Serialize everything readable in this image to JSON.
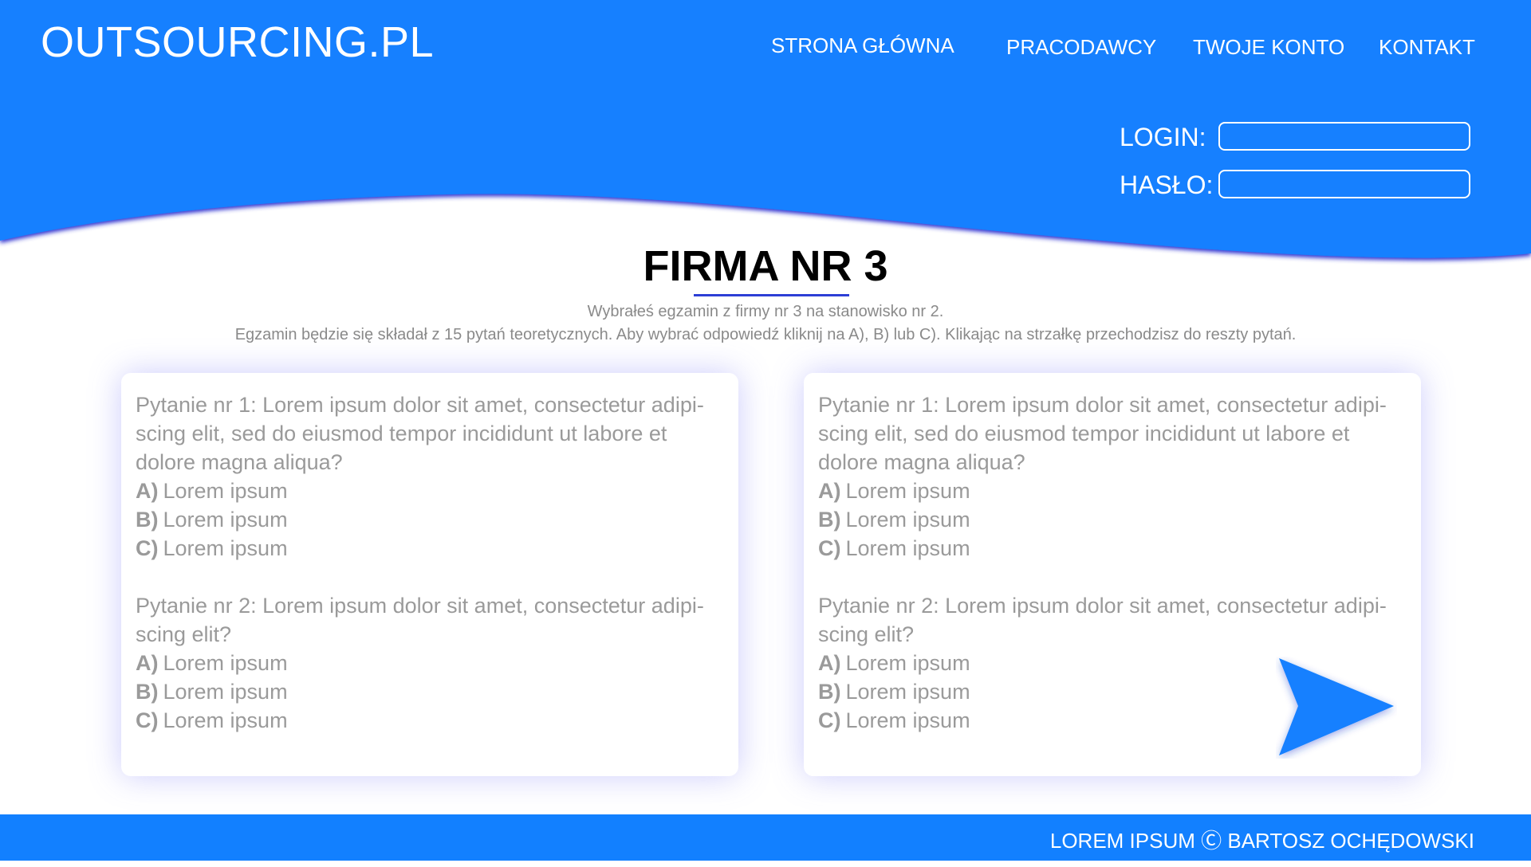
{
  "brand": {
    "logo": "OUTSOURCING.PL"
  },
  "nav": {
    "items": [
      {
        "label": "STRONA GŁÓWNA"
      },
      {
        "label": "PRACODAWCY"
      },
      {
        "label": "TWOJE KONTO"
      },
      {
        "label": "KONTAKT"
      }
    ]
  },
  "login": {
    "login_label": "LOGIN:",
    "login_value": "",
    "password_label": "HASŁO:",
    "password_value": ""
  },
  "page": {
    "title": "FIRMA NR 3",
    "subtitle_1": "Wybrałeś egzamin z firmy nr 3 na stanowisko nr 2.",
    "subtitle_2": "Egzamin będzie się składał z 15 pytań teoretycznych. Aby wybrać odpowiedź kliknij na A), B) lub C). Klikając na strzałkę przechodzisz do reszty pytań."
  },
  "cards": [
    {
      "questions": [
        {
          "text": "Pytanie nr 1: Lorem ipsum dolor sit amet, consectetur adipi-scing elit, sed do eiusmod tempor incididunt ut labore et dolore magna aliqua?",
          "answers": [
            {
              "letter": "A)",
              "text": "Lorem ipsum"
            },
            {
              "letter": "B)",
              "text": "Lorem ipsum"
            },
            {
              "letter": "C)",
              "text": "Lorem ipsum"
            }
          ]
        },
        {
          "text": "Pytanie nr 2: Lorem ipsum dolor sit amet, consectetur adipi-scing elit?",
          "answers": [
            {
              "letter": "A)",
              "text": "Lorem ipsum"
            },
            {
              "letter": "B)",
              "text": "Lorem ipsum"
            },
            {
              "letter": "C)",
              "text": "Lorem ipsum"
            }
          ]
        }
      ]
    },
    {
      "questions": [
        {
          "text": "Pytanie nr 1: Lorem ipsum dolor sit amet, consectetur adipi-scing elit, sed do eiusmod tempor incididunt ut labore et dolore magna aliqua?",
          "answers": [
            {
              "letter": "A)",
              "text": "Lorem ipsum"
            },
            {
              "letter": "B)",
              "text": "Lorem ipsum"
            },
            {
              "letter": "C)",
              "text": "Lorem ipsum"
            }
          ]
        },
        {
          "text": "Pytanie nr 2: Lorem ipsum dolor sit amet, consectetur adipi-scing elit?",
          "answers": [
            {
              "letter": "A)",
              "text": "Lorem ipsum"
            },
            {
              "letter": "B)",
              "text": "Lorem ipsum"
            },
            {
              "letter": "C)",
              "text": "Lorem ipsum"
            }
          ]
        }
      ]
    }
  ],
  "next_button": {
    "icon": "arrow-right-icon"
  },
  "footer": {
    "text": "LOREM IPSUM Ⓒ BARTOSZ OCHĘDOWSKI"
  },
  "colors": {
    "primary": "#1280ff",
    "wave_shadow": "#2b2fd0",
    "title_underline": "#2d3fd6",
    "text_muted": "#9a9a9a"
  }
}
